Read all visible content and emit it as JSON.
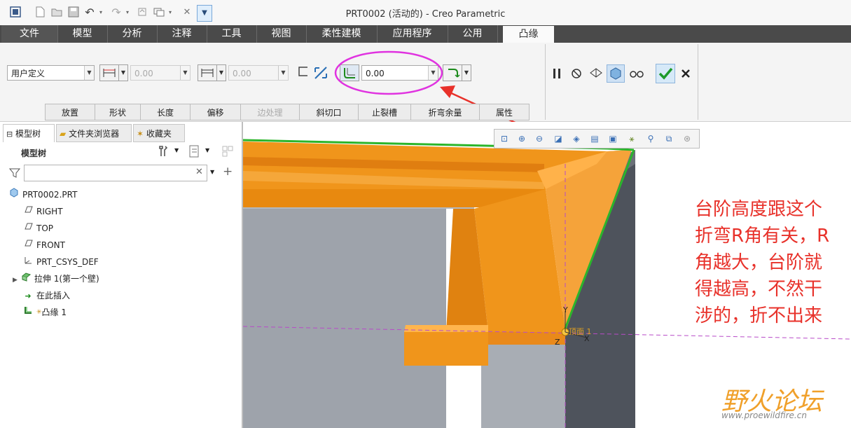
{
  "window": {
    "title": "PRT0002 (活动的) - Creo Parametric"
  },
  "quick_access": [
    "app-menu-icon",
    "new-icon",
    "open-icon",
    "save-icon",
    "undo-icon",
    "redo-icon",
    "regenerate-icon",
    "windows-icon",
    "close-window-icon",
    "customize-icon"
  ],
  "ribbon": {
    "tabs": [
      "文件",
      "模型",
      "分析",
      "注释",
      "工具",
      "视图",
      "柔性建模",
      "应用程序",
      "公用",
      "凸缘"
    ],
    "active_tab": "凸缘"
  },
  "dashboard": {
    "shape_select": "用户定义",
    "length1_value": "0.00",
    "length2_value": "0.00",
    "bend_relief_value": "0.00",
    "subtabs": [
      "放置",
      "形状",
      "长度",
      "偏移",
      "边处理",
      "斜切口",
      "止裂槽",
      "折弯余量",
      "属性"
    ],
    "disabled_subtabs": [
      "边处理"
    ],
    "actions": {
      "pause": "pause-icon",
      "no_preview": "no-preview-icon",
      "preview": "preview-icon",
      "verify": "verify-icon",
      "glasses": "glasses-icon",
      "ok": "check-icon",
      "cancel": "close-icon"
    }
  },
  "navigator": {
    "tabs": [
      "模型树",
      "文件夹浏览器",
      "收藏夹"
    ],
    "header": "模型树",
    "filter_placeholder": "",
    "tree": [
      {
        "label": "PRT0002.PRT",
        "icon": "part-icon",
        "indent": 0
      },
      {
        "label": "RIGHT",
        "icon": "datum-plane-icon",
        "indent": 1
      },
      {
        "label": "TOP",
        "icon": "datum-plane-icon",
        "indent": 1
      },
      {
        "label": "FRONT",
        "icon": "datum-plane-icon",
        "indent": 1
      },
      {
        "label": "PRT_CSYS_DEF",
        "icon": "csys-icon",
        "indent": 1
      },
      {
        "label": "拉伸 1(第一个壁)",
        "icon": "extrude-icon",
        "indent": 1
      },
      {
        "label": "在此插入",
        "icon": "insert-arrow-icon",
        "indent": 1
      },
      {
        "label": "凸缘 1",
        "icon": "flange-icon",
        "indent": 1
      }
    ]
  },
  "viewport": {
    "datum_label": "顶面 1",
    "axis_labels": {
      "x": "X",
      "y": "Y",
      "z": "Z"
    },
    "annotation": "台阶高度跟这个折弯R角有关，R角越大，台阶就得越高，不然干涉的，折不出来",
    "annotation_lines": [
      "台阶高度跟这个",
      "折弯R角有关，R",
      "角越大，台阶就",
      "得越高，不然干",
      "涉的，折不出来"
    ],
    "watermark": "野火论坛",
    "watermark_url": "www.proewildfire.cn"
  },
  "colors": {
    "tab_bg": "#4a4a4a",
    "orange": "#f0951b",
    "grey": "#9ea3ab",
    "annotation": "#e8312a",
    "highlight_green": "#2bb52b",
    "magenta": "#e033e0"
  }
}
